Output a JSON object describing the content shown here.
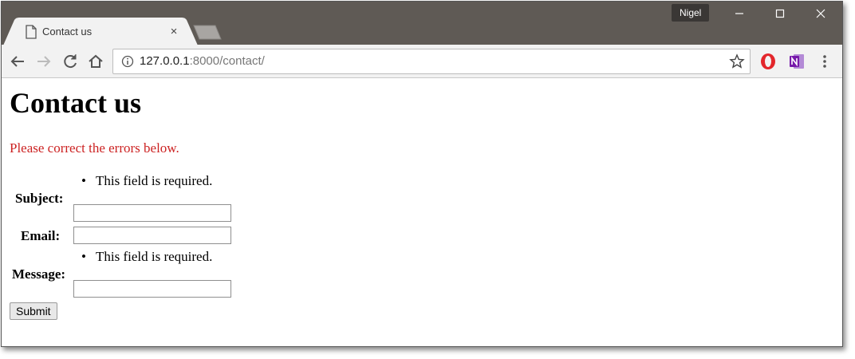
{
  "browser": {
    "tab_title": "Contact us",
    "tab_close": "×",
    "profile_name": "Nigel",
    "window_controls": {
      "minimize": "—",
      "maximize": "☐",
      "close": "✕"
    },
    "url_host": "127.0.0.1",
    "url_rest": ":8000/contact/",
    "icons": {
      "back": "back-arrow-icon",
      "forward": "forward-arrow-icon",
      "reload": "reload-icon",
      "home": "home-icon",
      "info": "info-icon",
      "bookmark": "star-icon",
      "opera": "opera-icon",
      "onenote": "onenote-icon",
      "menu": "kebab-menu-icon"
    }
  },
  "page": {
    "title": "Contact us",
    "error_note": "Please correct the errors below.",
    "subject": {
      "label": "Subject:",
      "error": "This field is required.",
      "value": ""
    },
    "email": {
      "label": "Email:",
      "value": ""
    },
    "message": {
      "label": "Message:",
      "error": "This field is required.",
      "value": ""
    },
    "submit_label": "Submit"
  },
  "colors": {
    "titlebar": "#5f5a55",
    "tab": "#f2f2f2",
    "error_text": "#cc2222"
  }
}
